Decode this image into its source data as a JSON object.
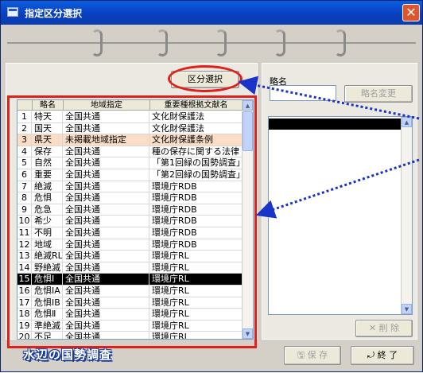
{
  "window": {
    "title": "指定区分選択",
    "close_glyph": "✕"
  },
  "left": {
    "select_button": "区分選択"
  },
  "table": {
    "headers": [
      "",
      "略名",
      "地域指定",
      "重要種根拠文献名"
    ],
    "rows": [
      [
        "1",
        "特天",
        "全国共通",
        "文化財保護法"
      ],
      [
        "2",
        "国天",
        "全国共通",
        "文化財保護法"
      ],
      [
        "3",
        "県天",
        "未掲載地域指定",
        "文化財保護条例"
      ],
      [
        "4",
        "保存",
        "全国共通",
        "種の保存に関する法律"
      ],
      [
        "5",
        "自然",
        "全国共通",
        "「第1回緑の国勢調査」"
      ],
      [
        "6",
        "重要",
        "全国共通",
        "「第2回緑の国勢調査」"
      ],
      [
        "7",
        "絶滅",
        "全国共通",
        "環境庁RDB"
      ],
      [
        "8",
        "危惧",
        "全国共通",
        "環境庁RDB"
      ],
      [
        "9",
        "危急",
        "全国共通",
        "環境庁RDB"
      ],
      [
        "10",
        "希少",
        "全国共通",
        "環境庁RDB"
      ],
      [
        "11",
        "不明",
        "全国共通",
        "環境庁RDB"
      ],
      [
        "12",
        "地域",
        "全国共通",
        "環境庁RDB"
      ],
      [
        "13",
        "絶滅RL",
        "全国共通",
        "環境庁RL"
      ],
      [
        "14",
        "野絶滅",
        "全国共通",
        "環境庁RL"
      ],
      [
        "15",
        "危惧Ⅰ",
        "全国共通",
        "環境庁RL"
      ],
      [
        "16",
        "危惧ⅠA",
        "全国共通",
        "環境庁RL"
      ],
      [
        "17",
        "危惧ⅠB",
        "全国共通",
        "環境庁RL"
      ],
      [
        "18",
        "危惧Ⅱ",
        "全国共通",
        "環境庁RL"
      ],
      [
        "19",
        "準絶滅",
        "全国共通",
        "環境庁RL"
      ],
      [
        "20",
        "不足",
        "全国共通",
        "環境庁RL"
      ]
    ]
  },
  "right": {
    "abbr_label": "略名",
    "abbr_value": "",
    "rename_button": "略名変更",
    "delete_button": "✕ 削 除"
  },
  "footer": {
    "logo_text": "水辺の国勢調査",
    "save_button": "🖫 保 存",
    "exit_button": "⤾ 終 了"
  },
  "colors": {
    "annotation": "#e1201c",
    "arrow": "#1a33c9",
    "title_bar": "#0b5fe0"
  }
}
